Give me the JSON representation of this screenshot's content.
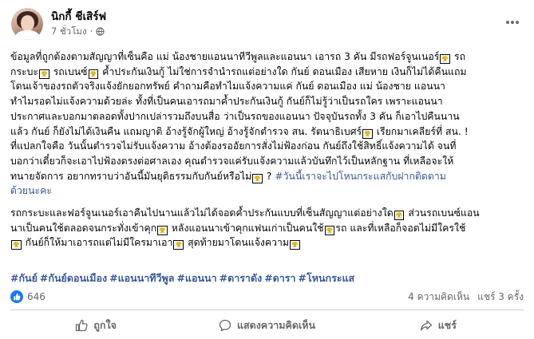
{
  "post": {
    "author_name": "นิกกี้ ชีเสิร์ฟ",
    "time_text": "7 ชั่วโมง",
    "dot": "·",
    "paragraphs": [
      {
        "lines": [
          {
            "segments": [
              {
                "text": "ข้อมูลที่ถูกต้องตามสัญญาที่เซ็นคือ แม่ น้องชายแอนนาทีวีพูลและแอนนา เอารถ 3 คัน มีรถฟอร์จูนเนอร์"
              },
              {
                "emoji": "😤"
              },
              {
                "text": " รถ"
              }
            ]
          },
          {
            "segments": [
              {
                "text": "กระบะ"
              },
              {
                "emoji": "😤"
              },
              {
                "text": " รถเบนซ์"
              },
              {
                "emoji": "😤"
              },
              {
                "text": " ค้ำประกันเงินกู้ ไม่ใช่การจำนำรถแต่อย่างใด กันย์ ดอนเมือง เสียหาย เงินก็ไม่ได้คืนแถม"
              }
            ]
          },
          {
            "segments": [
              {
                "text": "โดนเจ้าของรถตัวจริงแจ้งยักยอกทรัพย์ คำถามคือทำไมแจ้งความแค่ กันย์ ดอนเมือง แม่ น้องชาย แอนนา"
              }
            ]
          },
          {
            "segments": [
              {
                "text": "ทำไมรอดไม่แจ้งความด้วยล่ะ ทั้งที่เป็นคนเอารถมาค้ำประกันเงินกู้ กันย์ก็ไม่รู้ว่าเป็นรถใคร เพราะแอนนา"
              }
            ]
          },
          {
            "segments": [
              {
                "text": "ประกาศและบอกมาตลอดทั้งปากเปล่ารวมถึงบนสื่อ ว่าเป็นรถของแอนนา ปัจจุบันรถทั้ง 3 คัน ก็เอาไปคืนนาน"
              }
            ]
          },
          {
            "segments": [
              {
                "text": "แล้ว กันย์ ก็ยังไม่ได้เงินคืน แถมญาติ อ้างรู้จักผู้ใหญ่ อ้างรู้จักตำรวจ สน. รัตนาธิเบศร์"
              },
              {
                "emoji": "😤"
              },
              {
                "text": " เรียกมาเคลียร์ที่ สน. !"
              }
            ]
          },
          {
            "segments": [
              {
                "text": "ที่แปลกใจคือ วันนั้นตำรวจไม่รับแจ้งความ อ้างต้องรออัยการสั่งไม่ฟ้องก่อน กันย์ถึงใช้สิทธิ์แจ้งความได้ จนที่"
              }
            ]
          },
          {
            "segments": [
              {
                "text": "บอกว่าเดี๋ยวก็จะเอาไปฟ้องตรงต่อศาลเอง คุณตำรวจแค่รับแจ้งความแล้วบันทึกไว้เป็นหลักฐาน ที่เหลือจะให้"
              }
            ]
          },
          {
            "segments": [
              {
                "text": "ทนายจัดการ อยากทราบว่าอันนี้มันยุติธรรมกับกันย์หรือไม่"
              },
              {
                "emoji": "😤"
              },
              {
                "text": " ? "
              },
              {
                "link": "#วันนี้เราจะไปโหนกระแสกับฝากติดตาม"
              }
            ]
          },
          {
            "segments": [
              {
                "link": "ด้วยนะคะ"
              }
            ]
          }
        ]
      },
      {
        "lines": [
          {
            "segments": [
              {
                "text": "รถกระบะและฟอร์จูนเนอร์เอาคืนไปนานแล้วไม่ได้จอดค้ำประกันแบบที่เซ็นสัญญาแต่อย่างใด"
              },
              {
                "emoji": "😤"
              },
              {
                "text": " ส่วนรถเบนซ์แอน"
              }
            ]
          },
          {
            "segments": [
              {
                "text": "นาเป็นคนใช้ตลอดจนกระทั่งเข้าคุก"
              },
              {
                "emoji": "😤"
              },
              {
                "text": " หลังแอนนาเข้าคุกแฟนเก่าเป็นคนใช้"
              },
              {
                "emoji": "😤"
              },
              {
                "text": "รถ และที่เหลือก็จอดไม่มีใครใช้"
              }
            ]
          },
          {
            "segments": [
              {
                "emoji": "😤"
              },
              {
                "text": " กันย์ก็ให้มาเอารถแต่ไม่มีใครมาเอา"
              },
              {
                "emoji": "😤"
              },
              {
                "text": " สุดท้ายมาโดนแจ้งความ"
              },
              {
                "emoji": "😤"
              }
            ]
          }
        ]
      }
    ],
    "hashtags": [
      "#กันย์",
      "#กันย์ดอนเมือง",
      "#แอนนาทีวีพูล",
      "#แอนนา",
      "#ดาราดัง",
      "#ดารา",
      "#โหนกระแส"
    ],
    "like_count": "646",
    "comments_text": "4 ความคิดเห็น",
    "shares_text": "แชร์ 3 ครั้ง",
    "actions": {
      "like_label": "ถูกใจ",
      "comment_label": "แสดงความคิดเห็น",
      "share_label": "แชร์"
    },
    "colors": {
      "link": "#385898",
      "like_blue": "#1877f2",
      "secondary_text": "#65676b"
    }
  }
}
